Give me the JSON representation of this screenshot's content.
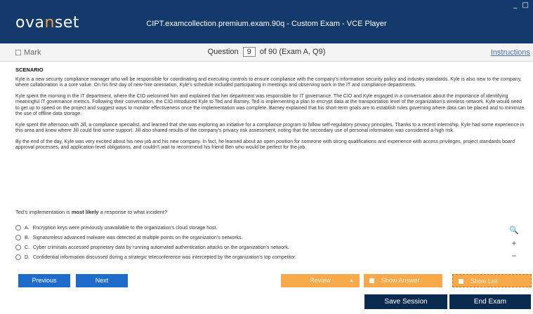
{
  "app": {
    "logo_main": "ova",
    "logo_accent": "n",
    "logo_tail": "set",
    "window_title": "CIPT.examcollection.premium.exam.90q - Custom Exam - VCE Player",
    "window_controls": "_ □"
  },
  "question_bar": {
    "mark_label": "Mark",
    "question_prefix": "Question",
    "question_number": "9",
    "question_suffix": "of 90 (Exam A, Q9)",
    "instructions_label": "Instructions"
  },
  "scenario": {
    "heading": "SCENARIO",
    "paragraphs": [
      "Kyle is a new security compliance manager who will be responsible for coordinating and executing controls to ensure compliance with the company's information security policy and industry standards. Kyle is also new to the company, where collaboration is a core value. On his first day of new-hire orientation, Kyle's schedule included participating in meetings and observing work in the IT and compliance departments.",
      "Kyle spent the morning in the IT department, where the CIO welcomed him and explained that her department was responsible for IT governance. The CIO and Kyle engaged in a conversation about the importance of identifying meaningful IT governance metrics. Following their conversation, the CIO introduced Kyle to Ted and Barney. Ted is implementing a plan to encrypt data at the transportation level of the organization's wireless network. Kyle would need to get up to speed on the project and suggest ways to monitor effectiveness once the implementation was complete. Barney explained that his short-term goals are to establish rules governing where data can be placed and to minimize the use of offline data storage.",
      "Kyle spent the afternoon with Jill, a compliance specialist, and learned that she was exploring an initiative for a compliance program to follow self-regulatory privacy principles. Thanks to a recent internship, Kyle had some experience in this area and knew where Jill could find some support. Jill also shared results of the company's privacy risk assessment, noting that the secondary use of personal information was considered a high risk.",
      "By the end of the day, Kyle was very excited about his new job and his new company. In fact, he learned about an open position for someone with strong qualifications and experience with access privileges, project standards board approval processes, and application-level obligations, and couldn't wait to recommend his friend Ben who would be perfect for the job."
    ]
  },
  "question": {
    "text_before": "Ted's implementation is ",
    "text_bold": "most likely",
    "text_after": " a response to what incident?",
    "options": [
      {
        "letter": "A.",
        "text": "Encryption keys were previously unavailable to the organization's cloud storage host."
      },
      {
        "letter": "B.",
        "text": "Signatureless advanced malware was detected at multiple points on the organization's networks."
      },
      {
        "letter": "C.",
        "text": "Cyber criminals accessed proprietary data by running automated authentication attacks on the organization's network."
      },
      {
        "letter": "D.",
        "text": "Confidential information discussed during a strategic teleconference was intercepted by the organization's top competitor."
      }
    ]
  },
  "zoom": {
    "magnifier_icon": "🔍",
    "plus": "+",
    "minus": "−"
  },
  "nav": {
    "previous_label": "Previous",
    "next_label": "Next",
    "review_label": "Review",
    "review_caret": "▲",
    "show_answer_label": "Show Answer",
    "show_list_label": "Show List"
  },
  "footer": {
    "save_label": "Save Session",
    "end_label": "End Exam"
  },
  "colors": {
    "titlebar": "#133a6a",
    "primary_button": "#1e6bc9",
    "accent_button": "#f8a94a",
    "dark_button": "#0b2a4f"
  }
}
